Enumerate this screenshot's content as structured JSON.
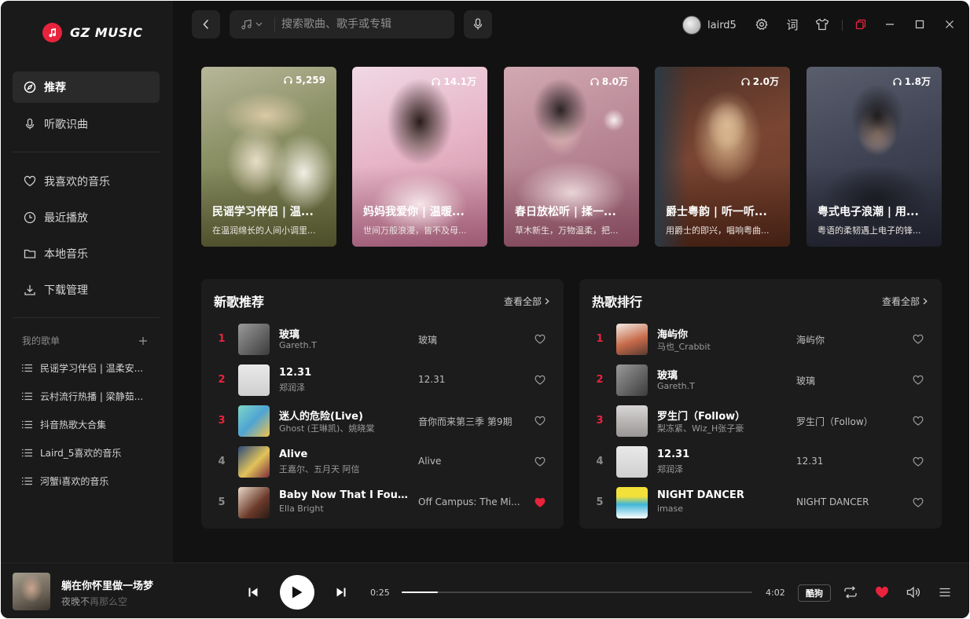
{
  "app": {
    "logo_text": "GZ MUSIC",
    "accent": "#e8233c"
  },
  "sidebar": {
    "nav": [
      {
        "label": "推荐",
        "icon": "compass-icon",
        "active": true
      },
      {
        "label": "听歌识曲",
        "icon": "microphone-icon",
        "active": false
      }
    ],
    "library": [
      {
        "label": "我喜欢的音乐",
        "icon": "heart-icon"
      },
      {
        "label": "最近播放",
        "icon": "clock-icon"
      },
      {
        "label": "本地音乐",
        "icon": "folder-icon"
      },
      {
        "label": "下载管理",
        "icon": "download-icon"
      }
    ],
    "playlists_header": "我的歌单",
    "playlists": [
      "民谣学习伴侣 | 温柔安...",
      "云村流行热播 | 梁静茹...",
      "抖音热歌大合集",
      "Laird_5喜欢的音乐",
      "河蟹i喜欢的音乐"
    ]
  },
  "topbar": {
    "search_placeholder": "搜索歌曲、歌手或专辑",
    "username": "laird5",
    "lyrics_label": "词"
  },
  "cards": [
    {
      "plays": "5,259",
      "title": "民谣学习伴侣 | 温...",
      "desc": "在温润绵长的人间小调里..."
    },
    {
      "plays": "14.1万",
      "title": "妈妈我爱你 | 温暖...",
      "desc": "世间万般浪漫，皆不及母..."
    },
    {
      "plays": "8.0万",
      "title": "春日放松听 | 揉一...",
      "desc": "草木新生，万物温柔，把..."
    },
    {
      "plays": "2.0万",
      "title": "爵士粤韵 | 听一听...",
      "desc": "用爵士的即兴，唱响粤曲..."
    },
    {
      "plays": "1.8万",
      "title": "粤式电子浪潮 | 用...",
      "desc": "粤语的柔韧遇上电子的锋..."
    }
  ],
  "new_songs": {
    "title": "新歌推荐",
    "see_all": "查看全部",
    "rows": [
      {
        "rank": "1",
        "song": "玻璃",
        "artist": "Gareth.T",
        "album": "玻璃",
        "liked": false
      },
      {
        "rank": "2",
        "song": "12.31",
        "artist": "郑润泽",
        "album": "12.31",
        "liked": false
      },
      {
        "rank": "3",
        "song": "迷人的危险(Live)",
        "artist": "Ghost (王琳凯)、姚晓棠",
        "album": "音你而来第三季 第9期",
        "liked": false
      },
      {
        "rank": "4",
        "song": "Alive",
        "artist": "王嘉尔、五月天 阿信",
        "album": "Alive",
        "liked": false
      },
      {
        "rank": "5",
        "song": "Baby Now That I Found ...",
        "artist": "Ella Bright",
        "album": "Off Campus: The Mi...",
        "liked": true
      }
    ]
  },
  "hot_songs": {
    "title": "热歌排行",
    "see_all": "查看全部",
    "rows": [
      {
        "rank": "1",
        "song": "海屿你",
        "artist": "马也_Crabbit",
        "album": "海屿你",
        "liked": false
      },
      {
        "rank": "2",
        "song": "玻璃",
        "artist": "Gareth.T",
        "album": "玻璃",
        "liked": false
      },
      {
        "rank": "3",
        "song": "罗生门（Follow）",
        "artist": "梨冻紧、Wiz_H张子豪",
        "album": "罗生门（Follow）",
        "liked": false
      },
      {
        "rank": "4",
        "song": "12.31",
        "artist": "郑润泽",
        "album": "12.31",
        "liked": false
      },
      {
        "rank": "5",
        "song": "NIGHT DANCER",
        "artist": "imase",
        "album": "NIGHT DANCER",
        "liked": false
      }
    ]
  },
  "player": {
    "title": "躺在你怀里做一场梦",
    "artist_main": "夜晚不",
    "artist_faded": "再那么空",
    "current_time": "0:25",
    "total_time": "4:02",
    "progress": 0.104,
    "quality": "酷狗"
  }
}
